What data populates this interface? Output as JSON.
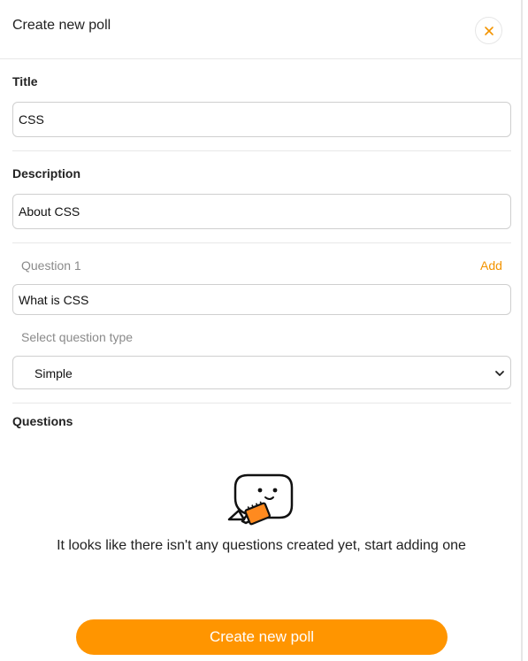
{
  "header": {
    "title": "Create new poll",
    "close_icon": "close-icon"
  },
  "title_section": {
    "label": "Title",
    "value": "CSS"
  },
  "description_section": {
    "label": "Description",
    "value": "About CSS"
  },
  "question_section": {
    "label": "Question 1",
    "add_label": "Add",
    "value": "What is CSS",
    "type_label": "Select question type",
    "type_value": "Simple"
  },
  "questions_section": {
    "label": "Questions",
    "empty_message": "It looks like there isn't any questions created yet, start adding one",
    "illustration_icon": "speech-bubble-illustration"
  },
  "footer": {
    "create_label": "Create new poll"
  },
  "colors": {
    "accent": "#ff9500",
    "accent_text": "#f39400"
  }
}
